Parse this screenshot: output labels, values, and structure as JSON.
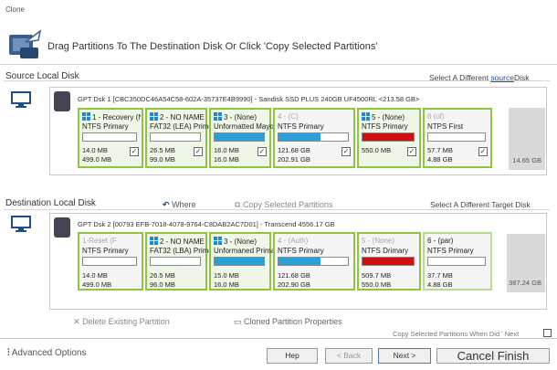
{
  "window": {
    "title": "Clone"
  },
  "header": {
    "instruction": "Drag Partitions To The Destination Disk Or Click 'Copy Selected Partitions'"
  },
  "source": {
    "title": "Source Local Disk",
    "link_prefix": "Select A Different ",
    "link_word": "source",
    "link_suffix": "Disk",
    "disk_info": "GPT Dsk 1 [CBC350DC46A54C58-602A-35737E4B9990] - Sandisk SSD PLUS 240GB UF4500RL <213.58 GB>",
    "partitions": [
      {
        "name": "1 - Recovery (N",
        "type": "NTFS Primary",
        "used": "14.0 MB",
        "total": "499.0 MB",
        "fill_pct": 0,
        "fill_color": "#2a9fd8",
        "checked": true,
        "style": "win"
      },
      {
        "name": "2 - NO NAME (",
        "type": "FAT32 (LEA) Primus",
        "used": "26.5 MB",
        "total": "99.0 MB",
        "fill_pct": 0,
        "fill_color": "#2a9fd8",
        "checked": true,
        "style": "win"
      },
      {
        "name": "3 - (None)",
        "type": "Unformatted Mayor",
        "used": "16.0 MB",
        "total": "16.0 MB",
        "fill_pct": 100,
        "fill_color": "#2a9fd8",
        "checked": true,
        "style": "win"
      },
      {
        "name": "4 - (C)",
        "type": "NTFS Primary",
        "used": "121.68 GB",
        "total": "202.91 GB",
        "fill_pct": 60,
        "fill_color": "#2a9fd8",
        "checked": true,
        "style": "faded"
      },
      {
        "name": "5 - (None)",
        "type": "NTFS Primary",
        "used": "550.0 MB",
        "total": "",
        "fill_pct": 100,
        "fill_color": "#d01010",
        "checked": true,
        "style": "win"
      },
      {
        "name": "6 (of)",
        "type": "NTPS First",
        "used": "57.7 MB",
        "total": "4.88 GB",
        "fill_pct": 0,
        "fill_color": "#2a9fd8",
        "checked": true,
        "style": "faded"
      }
    ],
    "unallocated": "14.65 GB"
  },
  "toolbar_mid": {
    "where": "Where",
    "copy": "Copy Selected Partitions"
  },
  "destination": {
    "title": "Destination Local Disk",
    "link": "Select A Different Target Disk",
    "disk_info": "GPT Dsk 2 [00793 EFB-7018-4078-9764-C8DAB2AC7D01] - Transcend 4556.17 GB",
    "partitions": [
      {
        "name": "1-Reset (F",
        "type": "NTFS Primary",
        "used": "14.0 MB",
        "total": "499.0 MB",
        "fill_pct": 0,
        "fill_color": "#2a9fd8",
        "style": "faded"
      },
      {
        "name": "2 - NO NAME (",
        "type": "FAT32 (LBA) Prime",
        "used": "26.5 MB",
        "total": "96.0 MB",
        "fill_pct": 0,
        "fill_color": "#2a9fd8",
        "style": "win"
      },
      {
        "name": "3 - (None)",
        "type": "Unformaned Primar",
        "used": "15.0 MB",
        "total": "16.0 MB",
        "fill_pct": 100,
        "fill_color": "#2a9fd8",
        "style": "win"
      },
      {
        "name": "4 - (Auth)",
        "type": "NTFS Primary",
        "used": "121.68 GB",
        "total": "202.90 GB",
        "fill_pct": 60,
        "fill_color": "#2a9fd8",
        "style": "faded"
      },
      {
        "name": "5 - (None)",
        "type": "NTFS Drimary",
        "used": "509.7 MB",
        "total": "550.0 MB",
        "fill_pct": 100,
        "fill_color": "#d01010",
        "style": "faded"
      },
      {
        "name": "6 - (par)",
        "type": "NTFS Primary",
        "used": "37.7 MB",
        "total": "4.88 GB",
        "fill_pct": 0,
        "fill_color": "#2a9fd8",
        "style": "plain"
      }
    ],
    "unallocated": "387.24 GB"
  },
  "toolbar_bottom": {
    "delete": "Delete Existing Partition",
    "properties": "Cloned Partition Properties",
    "note": "Copy Selected Partitions When Did ' Next"
  },
  "footer": {
    "advanced": "Advanced Options",
    "help": "Hep",
    "back": "< Back",
    "next": "Next >",
    "cancel_finish": "Cancel Finish"
  },
  "colors": {
    "accent": "#8cc63f",
    "used_bar": "#2a9fd8",
    "system_bar": "#d01010",
    "link": "#1a56b0"
  }
}
